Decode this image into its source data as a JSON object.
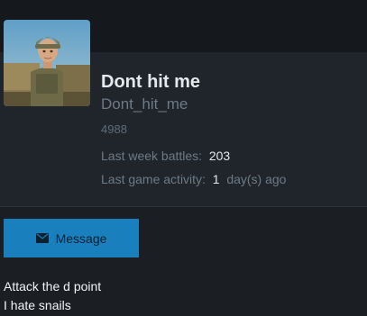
{
  "profile": {
    "avatar_icon": "soldier-avatar-icon",
    "name": "Dont hit me",
    "username": "Dont_hit_me",
    "player_id": "4988",
    "last_week_battles_label": "Last week battles",
    "last_week_battles_value": "203",
    "last_activity_label": "Last game activity",
    "last_activity_value": "1",
    "last_activity_unit": "day(s) ago"
  },
  "actions": {
    "message_label": "Message",
    "message_icon": "envelope-icon"
  },
  "bio": {
    "lines": [
      "Attack the d point",
      "I hate snails"
    ]
  },
  "colors": {
    "accent": "#1a7fbd",
    "background": "#1b1f24",
    "card": "#1f252b"
  }
}
